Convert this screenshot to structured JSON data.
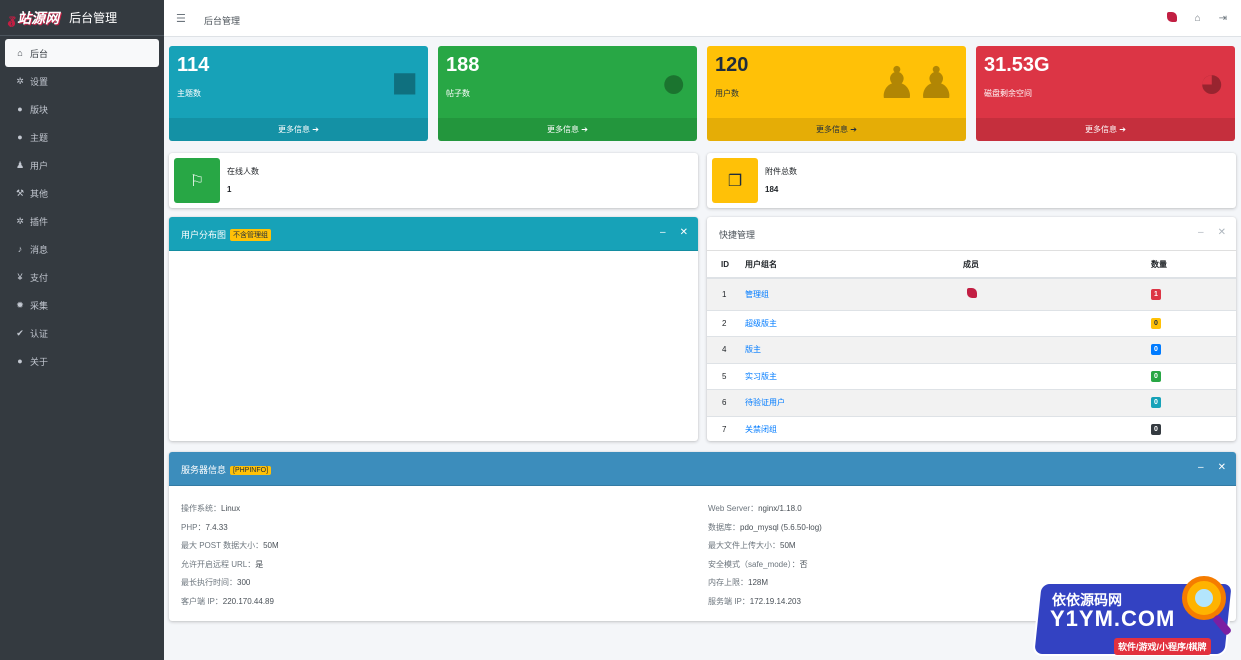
{
  "sidebar": {
    "logo": "站源网",
    "title": "后台管理",
    "items": [
      {
        "icon": "home-icon",
        "glyph": "⌂",
        "label": "后台",
        "active": true
      },
      {
        "icon": "gear-icon",
        "glyph": "✲",
        "label": "设置"
      },
      {
        "icon": "comment-icon",
        "glyph": "●",
        "label": "版块"
      },
      {
        "icon": "comment-icon",
        "glyph": "●",
        "label": "主题"
      },
      {
        "icon": "user-icon",
        "glyph": "♟",
        "label": "用户"
      },
      {
        "icon": "wrench-icon",
        "glyph": "⚒",
        "label": "其他"
      },
      {
        "icon": "cogs-icon",
        "glyph": "✲",
        "label": "插件"
      },
      {
        "icon": "bell-icon",
        "glyph": "♪",
        "label": "消息"
      },
      {
        "icon": "yen-icon",
        "glyph": "¥",
        "label": "支付"
      },
      {
        "icon": "spider-icon",
        "glyph": "✹",
        "label": "采集"
      },
      {
        "icon": "check-icon",
        "glyph": "✔",
        "label": "认证"
      },
      {
        "icon": "info-icon",
        "glyph": "●",
        "label": "关于"
      }
    ]
  },
  "topbar": {
    "breadcrumb": "后台管理"
  },
  "stats": [
    {
      "value": "114",
      "label": "主题数",
      "more": "更多信息 ➔",
      "color": "#17a2b8",
      "icon": "comment-icon"
    },
    {
      "value": "188",
      "label": "帖子数",
      "more": "更多信息 ➔",
      "color": "#28a745",
      "icon": "comments-icon"
    },
    {
      "value": "120",
      "label": "用户数",
      "more": "更多信息 ➔",
      "color": "#ffc107",
      "icon": "users-icon"
    },
    {
      "value": "31.53G",
      "label": "磁盘剩余空间",
      "more": "更多信息 ➔",
      "color": "#dc3545",
      "icon": "pie-chart-icon"
    }
  ],
  "info": {
    "online": {
      "label": "在线人数",
      "value": "1"
    },
    "attach": {
      "label": "附件总数",
      "value": "184"
    }
  },
  "userDist": {
    "title": "用户分布图",
    "badge": "不含管理组"
  },
  "quick": {
    "title": "快捷管理",
    "headers": [
      "ID",
      "用户组名",
      "成员",
      "数量"
    ],
    "rows": [
      {
        "id": "1",
        "name": "管理组",
        "count": "1",
        "color": "#dc3545"
      },
      {
        "id": "2",
        "name": "超级版主",
        "count": "0",
        "color": "#ffc107"
      },
      {
        "id": "4",
        "name": "版主",
        "count": "0",
        "color": "#007bff"
      },
      {
        "id": "5",
        "name": "实习版主",
        "count": "0",
        "color": "#28a745"
      },
      {
        "id": "6",
        "name": "待验证用户",
        "count": "0",
        "color": "#17a2b8"
      },
      {
        "id": "7",
        "name": "关禁闭组",
        "count": "0",
        "color": "#343a40"
      }
    ]
  },
  "server": {
    "title": "服务器信息",
    "badge": "[PHPINFO]",
    "left": [
      {
        "k": "操作系统：",
        "v": "Linux"
      },
      {
        "k": "PHP：",
        "v": "7.4.33"
      },
      {
        "k": "最大 POST 数据大小：",
        "v": "50M"
      },
      {
        "k": "允许开启远程 URL：",
        "v": "是"
      },
      {
        "k": "最长执行时间：",
        "v": "300"
      },
      {
        "k": "客户端 IP：",
        "v": "220.170.44.89"
      }
    ],
    "right": [
      {
        "k": "Web Server：",
        "v": "nginx/1.18.0"
      },
      {
        "k": "数据库：",
        "v": "pdo_mysql (5.6.50-log)"
      },
      {
        "k": "最大文件上传大小：",
        "v": "50M"
      },
      {
        "k": "安全模式（safe_mode）：",
        "v": "否"
      },
      {
        "k": "内存上限：",
        "v": "128M"
      },
      {
        "k": "服务端 IP：",
        "v": "172.19.14.203"
      }
    ]
  },
  "watermark": {
    "line1": "依依源码网",
    "line2": "Y1YM.COM",
    "line3": "软件/游戏/小程序/棋牌"
  }
}
